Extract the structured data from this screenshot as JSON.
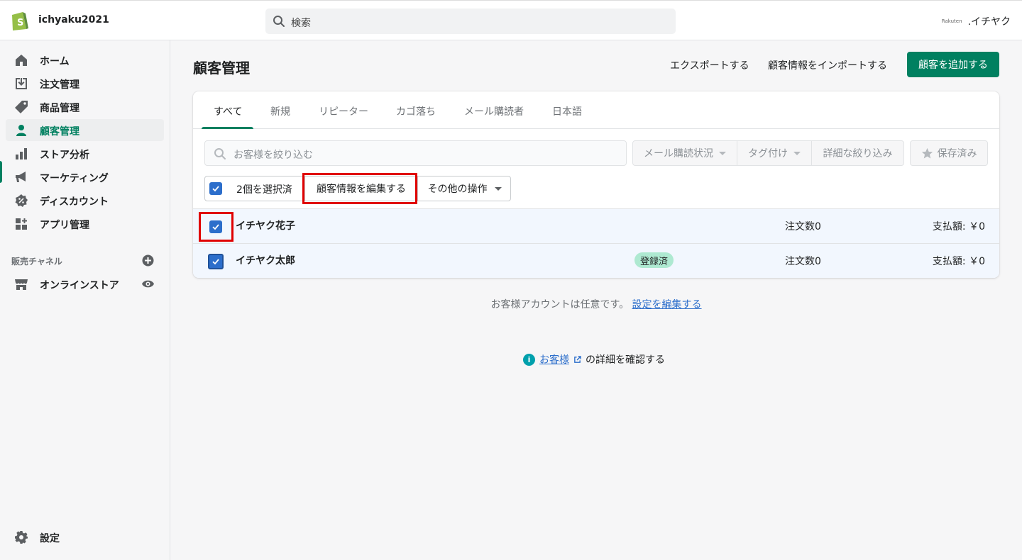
{
  "topbar": {
    "store_name": "ichyaku2021",
    "search_placeholder": "検索",
    "partner_logo_text": "Rakuten",
    "user_name": ".イチヤク"
  },
  "sidebar": {
    "items": [
      {
        "label": "ホーム",
        "icon": "home-icon"
      },
      {
        "label": "注文管理",
        "icon": "orders-icon"
      },
      {
        "label": "商品管理",
        "icon": "tag-icon"
      },
      {
        "label": "顧客管理",
        "icon": "customer-icon",
        "active": true
      },
      {
        "label": "ストア分析",
        "icon": "analytics-icon"
      },
      {
        "label": "マーケティング",
        "icon": "megaphone-icon"
      },
      {
        "label": "ディスカウント",
        "icon": "discount-icon"
      },
      {
        "label": "アプリ管理",
        "icon": "apps-icon"
      }
    ],
    "sales_channels_label": "販売チャネル",
    "channel": "オンラインストア",
    "settings": "設定"
  },
  "main": {
    "title": "顧客管理",
    "export_label": "エクスポートする",
    "import_label": "顧客情報をインポートする",
    "add_label": "顧客を追加する",
    "tabs": [
      "すべて",
      "新規",
      "リピーター",
      "カゴ落ち",
      "メール購読者",
      "日本語"
    ],
    "filter_placeholder": "お客様を絞り込む",
    "filters": {
      "email_status": "メール購読状況",
      "tagged": "タグ付け",
      "more_filters": "詳細な絞り込み",
      "saved": "保存済み"
    },
    "bulk": {
      "selected_text": "2個を選択済",
      "edit_label": "顧客情報を編集する",
      "more_actions": "その他の操作"
    },
    "customers": [
      {
        "name": "イチヤク花子",
        "badge": "",
        "orders": "注文数0",
        "paid": "支払額: ￥0",
        "checked": true
      },
      {
        "name": "イチヤク太郎",
        "badge": "登録済",
        "orders": "注文数0",
        "paid": "支払額: ￥0",
        "checked": true
      }
    ],
    "footnote_text": "お客様アカウントは任意です。",
    "footnote_link": "設定を編集する",
    "info_link": "お客様",
    "info_suffix": "の詳細を確認する"
  },
  "colors": {
    "primary": "#008060",
    "checkbox": "#2c6ecb",
    "highlight": "#e00000",
    "badge_bg": "#aee9d1"
  }
}
